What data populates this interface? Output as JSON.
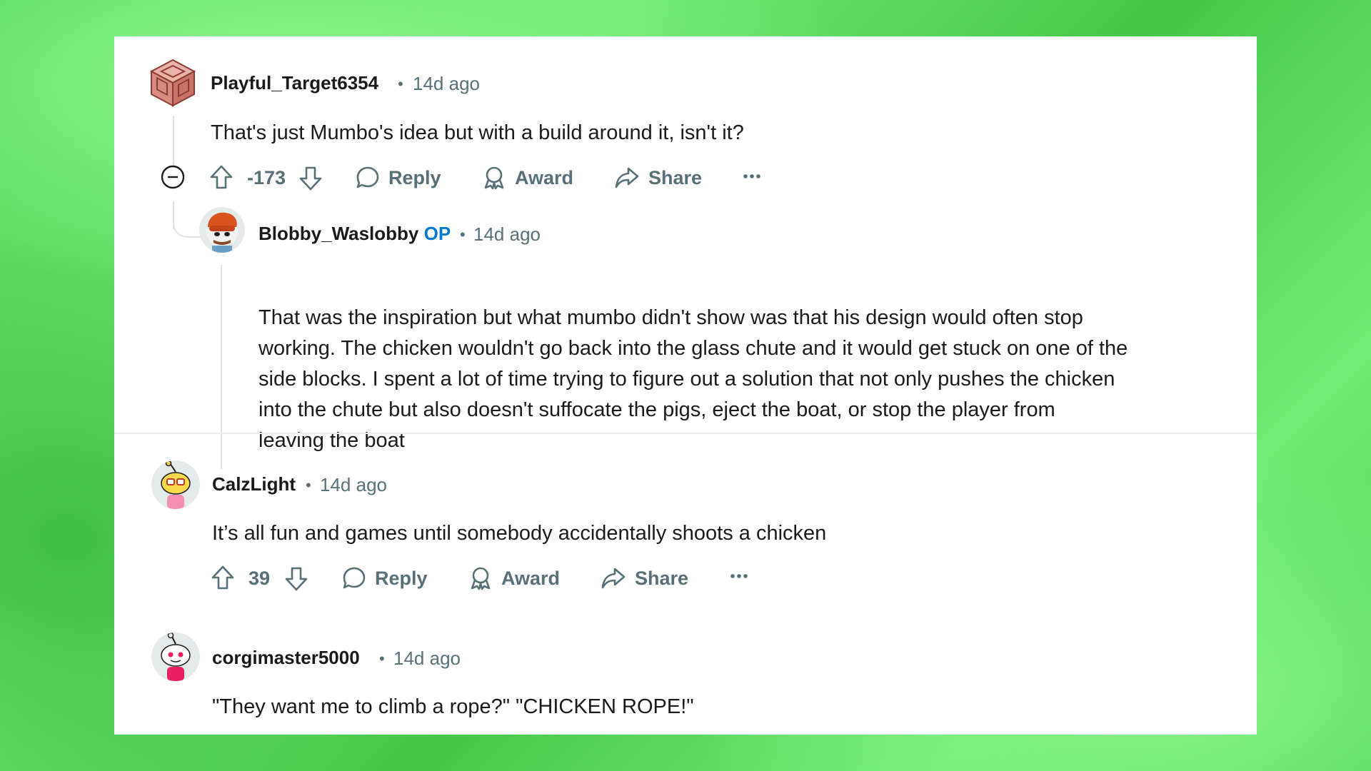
{
  "comments": [
    {
      "username": "Playful_Target6354",
      "time": "14d ago",
      "body": "That's just Mumbo's idea but with a build around it, isn't it?",
      "score": "-173",
      "actions": {
        "reply": "Reply",
        "award": "Award",
        "share": "Share"
      }
    },
    {
      "username": "Blobby_Waslobby",
      "badge": "OP",
      "time": "14d ago",
      "body_lines": [
        "That was the inspiration but what mumbo didn't show was that his design would often stop",
        "working. The chicken wouldn't go back into the glass chute and it would get stuck on one of the",
        "side blocks. I spent a lot of time trying to figure out a solution that not only pushes the chicken",
        "into the chute but also doesn't suffocate the pigs, eject the boat, or stop the player from",
        "leaving the boat"
      ]
    },
    {
      "username": "CalzLight",
      "time": "14d ago",
      "body": "It’s all fun and games until somebody accidentally shoots a chicken",
      "score": "39",
      "actions": {
        "reply": "Reply",
        "award": "Award",
        "share": "Share"
      }
    },
    {
      "username": "corgimaster5000",
      "time": "14d ago",
      "body": "\"They want me to climb a rope?\" \"CHICKEN ROPE!\""
    }
  ],
  "separator": "•",
  "icons": {
    "upvote": "arrow-up-icon",
    "downvote": "arrow-down-icon",
    "reply": "speech-bubble-icon",
    "award": "award-ribbon-icon",
    "share": "share-arrow-icon",
    "more": "ellipsis-icon",
    "collapse": "minus-circle-icon"
  },
  "colors": {
    "background": "#5cd85c",
    "card": "#ffffff",
    "op": "#0079d3",
    "meta": "#576f76",
    "text": "#1a1a1b"
  }
}
